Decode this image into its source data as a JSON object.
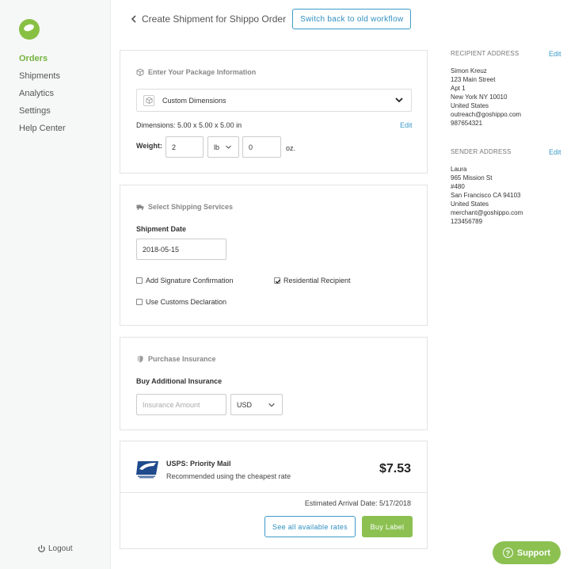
{
  "sidebar": {
    "items": [
      {
        "label": "Orders",
        "active": true
      },
      {
        "label": "Shipments"
      },
      {
        "label": "Analytics"
      },
      {
        "label": "Settings"
      },
      {
        "label": "Help Center"
      }
    ],
    "logout_label": "Logout",
    "accent_color": "#74b43e"
  },
  "header": {
    "title": "Create Shipment for Shippo Order",
    "switch_label": "Switch back to old workflow"
  },
  "package": {
    "heading": "Enter Your Package Information",
    "dimension_select": "Custom Dimensions",
    "dimensions_text": "Dimensions: 5.00 x 5.00 x 5.00 in",
    "edit_label": "Edit",
    "weight_label": "Weight:",
    "weight_value": "2",
    "weight_unit": "lb",
    "ounces_value": "0",
    "ounces_label": "oz."
  },
  "shipping": {
    "heading": "Select Shipping Services",
    "date_label": "Shipment Date",
    "date_value": "2018-05-15",
    "signature_label": "Add Signature Confirmation",
    "signature_checked": false,
    "residential_label": "Residential Recipient",
    "residential_checked": true,
    "customs_label": "Use Customs Declaration",
    "customs_checked": false
  },
  "insurance": {
    "heading": "Purchase Insurance",
    "label": "Buy Additional Insurance",
    "amount_placeholder": "Insurance Amount",
    "currency": "USD"
  },
  "rate": {
    "carrier_service": "USPS: Priority Mail",
    "note": "Recommended using the cheapest rate",
    "price": "$7.53",
    "arrival": "Estimated Arrival Date: 5/17/2018",
    "see_all_label": "See all available rates",
    "buy_label": "Buy Label"
  },
  "recipient": {
    "title": "RECIPIENT ADDRESS",
    "edit_label": "Edit",
    "lines": [
      "Simon Kreuz",
      "123 Main Street",
      "Apt 1",
      "New York NY 10010",
      "United States",
      "outreach@goshippo.com",
      "987654321"
    ]
  },
  "sender": {
    "title": "SENDER ADDRESS",
    "edit_label": "Edit",
    "lines": [
      "Laura",
      "965 Mission St",
      "#480",
      "San Francisco CA 94103",
      "United States",
      "merchant@goshippo.com",
      "123456789"
    ]
  },
  "support": {
    "label": "Support",
    "color": "#8cc152"
  },
  "colors": {
    "link": "#3d9bc9",
    "primary_green": "#8cc152"
  }
}
